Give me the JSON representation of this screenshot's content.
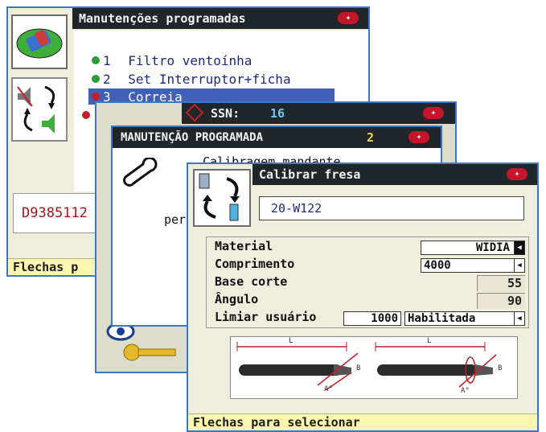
{
  "screen1": {
    "title": "Manutenções programadas",
    "items": [
      {
        "dot": "#2f9c3b",
        "num": "1",
        "label": "Filtro ventoínha"
      },
      {
        "dot": "#2f9c3b",
        "num": "2",
        "label": "Set Interruptor+ficha"
      },
      {
        "dot": "#c01e28",
        "num": "3",
        "label": "Correia"
      }
    ],
    "serial": "D9385112",
    "footer": "Flechas p"
  },
  "screen2": {
    "title": "SSN:",
    "ssn_value": "16"
  },
  "screen3": {
    "title": "MANUTENÇÃO PROGRAMADA",
    "count": "2",
    "line1": "Calibragem mandante",
    "line2": "per"
  },
  "screen4": {
    "title": "Calibrar fresa",
    "code": "20-W122",
    "fields": {
      "material_label": "Material",
      "material_value": "WIDIA",
      "comprimento_label": "Comprimento",
      "comprimento_value": "4000",
      "base_label": "Base corte",
      "base_value": "55",
      "angulo_label": "Ângulo",
      "angulo_value": "90",
      "limiar_label": "Limiar usuário",
      "limiar_value": "1000",
      "limiar_state": "Habilitada"
    },
    "diagram": {
      "dim_l": "L",
      "dim_b": "B",
      "dim_a": "A°"
    },
    "footer": "Flechas para selecionar"
  },
  "colors": {
    "frame": "#3a77c4",
    "titlebar": "#20262a",
    "footer": "#fbf6b0",
    "highlight": "#3f5fb8"
  }
}
